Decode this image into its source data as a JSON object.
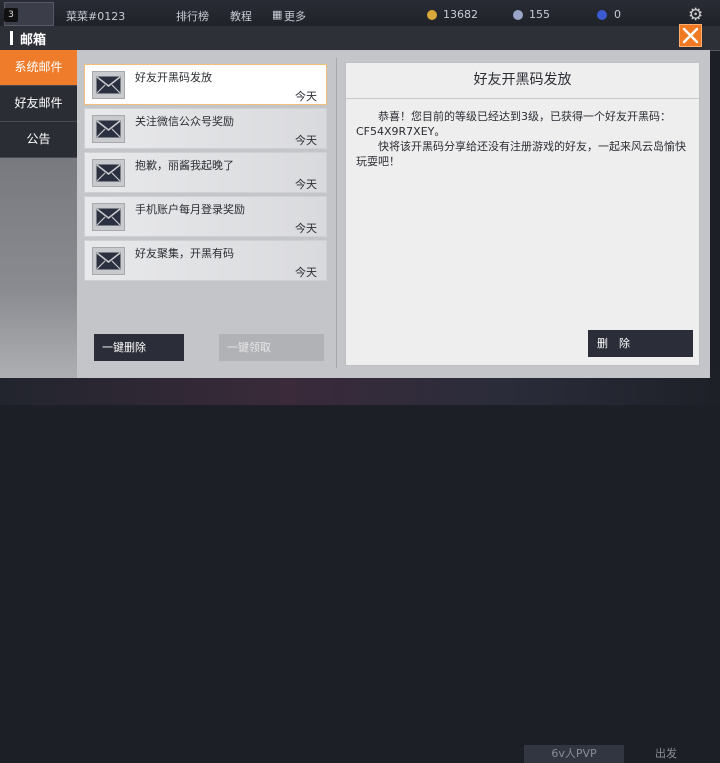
{
  "hud": {
    "level": "3",
    "player_name": "菜菜#0123",
    "nav_leaderboard": "排行榜",
    "nav_tutorial": "教程",
    "nav_more": "更多",
    "coins": "13682",
    "gems": "155",
    "energy": "0",
    "bottom_mode": "6v人PVP",
    "bottom_go": "出发"
  },
  "mailbox": {
    "title": "邮箱",
    "tabs": [
      {
        "label": "系统邮件",
        "active": true
      },
      {
        "label": "好友邮件",
        "active": false
      },
      {
        "label": "公告",
        "active": false
      }
    ],
    "mails": [
      {
        "subject": "好友开黑码发放",
        "date": "今天",
        "selected": true
      },
      {
        "subject": "关注微信公众号奖励",
        "date": "今天",
        "selected": false
      },
      {
        "subject": "抱歉，丽酱我起晚了",
        "date": "今天",
        "selected": false
      },
      {
        "subject": "手机账户每月登录奖励",
        "date": "今天",
        "selected": false
      },
      {
        "subject": "好友聚集，开黑有码",
        "date": "今天",
        "selected": false
      }
    ],
    "delete_all_label": "一键删除",
    "claim_all_label": "一键领取",
    "detail": {
      "title": "好友开黑码发放",
      "paragraph_1": "恭喜！您目前的等级已经达到3级，已获得一个好友开黑码：CF54X9R7XEY。",
      "paragraph_2": "快将该开黑码分享给还没有注册游戏的好友，一起来风云岛愉快玩耍吧！",
      "delete_label": "删　除"
    }
  },
  "colors": {
    "accent": "#ef7c2b",
    "dark_button": "#2b2e38",
    "panel_bg": "#c4c5c8"
  }
}
